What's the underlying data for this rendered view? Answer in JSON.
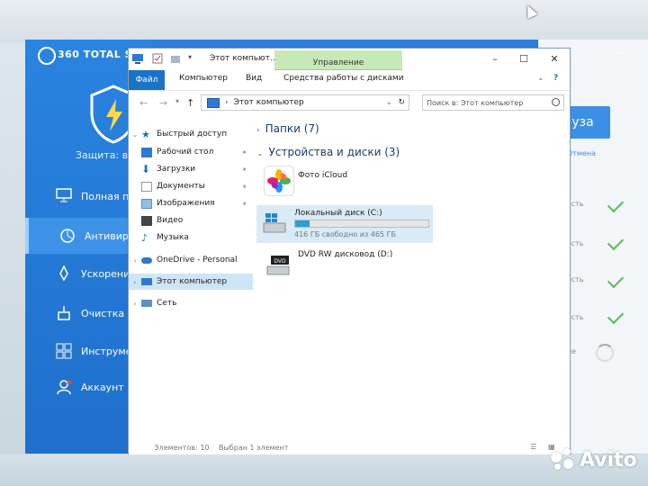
{
  "app360": {
    "title": "360 TOTAL S",
    "protection_label": "Защита: в",
    "nav": [
      {
        "label": "Полная п",
        "icon": "monitor-icon"
      },
      {
        "label": "Антивиру",
        "icon": "antivirus-icon"
      },
      {
        "label": "Ускорени",
        "icon": "rocket-icon"
      },
      {
        "label": "Очистка",
        "icon": "broom-icon"
      },
      {
        "label": "Инструме",
        "icon": "tools-icon"
      },
      {
        "label": "Аккаунт",
        "icon": "account-icon"
      }
    ],
    "pause_label": "Пауза",
    "cancel_label": "Отмена",
    "statuses": [
      "пасность",
      "пасность",
      "пасность",
      "пасность",
      "ование"
    ]
  },
  "explorer": {
    "title": "Этот компьют...",
    "management_tab": "Управление",
    "ribbon_tabs": [
      "Файл",
      "Компьютер",
      "Вид",
      "Средства работы с дисками"
    ],
    "address": "Этот компьютер",
    "search_placeholder": "Поиск в: Этот компьютер",
    "nav_items": [
      {
        "label": "Быстрый доступ",
        "pinned": false
      },
      {
        "label": "Рабочий стол",
        "pinned": true
      },
      {
        "label": "Загрузки",
        "pinned": true
      },
      {
        "label": "Документы",
        "pinned": true
      },
      {
        "label": "Изображения",
        "pinned": true
      },
      {
        "label": "Видео",
        "pinned": false
      },
      {
        "label": "Музыка",
        "pinned": false
      },
      {
        "label": "OneDrive - Personal",
        "pinned": false
      },
      {
        "label": "Этот компьютер",
        "pinned": false
      },
      {
        "label": "Сеть",
        "pinned": false
      }
    ],
    "groups": {
      "folders": "Папки (7)",
      "devices": "Устройства и диски (3)"
    },
    "drives": [
      {
        "name": "Фото iCloud"
      },
      {
        "name": "Локальный диск (C:)",
        "free": "416 ГБ свободно из 465 ГБ",
        "used_fraction": 0.105
      },
      {
        "name": "DVD RW дисковод (D:)"
      }
    ],
    "status_items": "Элементов: 10",
    "status_selected": "Выбран 1 элемент"
  },
  "watermark": "Avito",
  "colors": {
    "accent": "#1a73c7",
    "app_blue": "#2b7fd9",
    "capacity": "#26a0da"
  }
}
